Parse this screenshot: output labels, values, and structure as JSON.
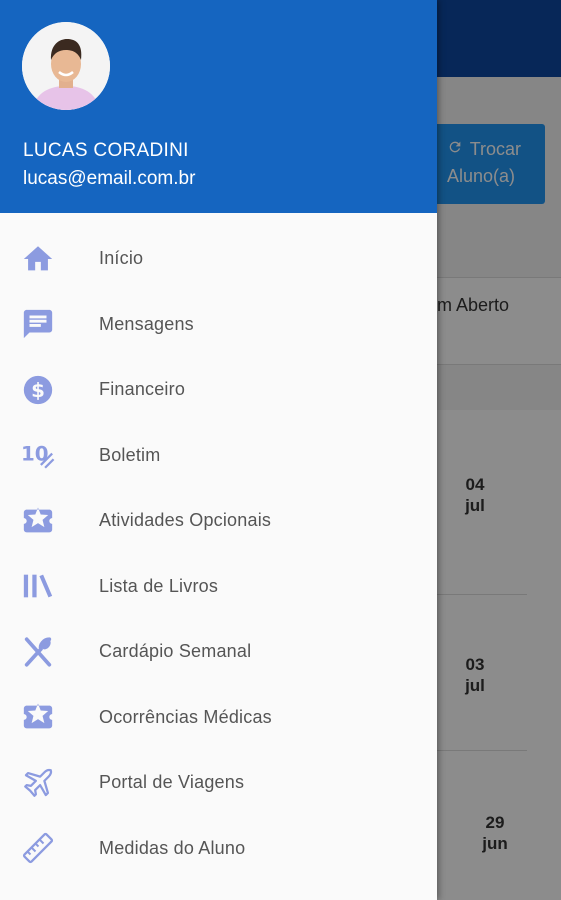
{
  "background": {
    "swap_button": {
      "icon": "refresh-icon",
      "line1": "Trocar",
      "line2": "Aluno(a)"
    },
    "status_text": "m Aberto",
    "dates": [
      {
        "day": "04",
        "month": "jul"
      },
      {
        "day": "03",
        "month": "jul"
      },
      {
        "day": "29",
        "month": "jun"
      }
    ]
  },
  "drawer": {
    "user": {
      "name": "LUCAS CORADINI",
      "email": "lucas@email.com.br"
    },
    "menu": [
      {
        "label": "Início",
        "icon": "home-icon"
      },
      {
        "label": "Mensagens",
        "icon": "message-icon"
      },
      {
        "label": "Financeiro",
        "icon": "dollar-icon"
      },
      {
        "label": "Boletim",
        "icon": "grade-icon"
      },
      {
        "label": "Atividades Opcionais",
        "icon": "ticket-star-icon"
      },
      {
        "label": "Lista de Livros",
        "icon": "books-icon"
      },
      {
        "label": "Cardápio Semanal",
        "icon": "utensils-icon"
      },
      {
        "label": "Ocorrências Médicas",
        "icon": "ticket-star-icon"
      },
      {
        "label": "Portal de Viagens",
        "icon": "airplane-icon"
      },
      {
        "label": "Medidas do Aluno",
        "icon": "ruler-icon"
      }
    ],
    "icon_color": "#8c9be0",
    "header_color": "#1565c0"
  }
}
